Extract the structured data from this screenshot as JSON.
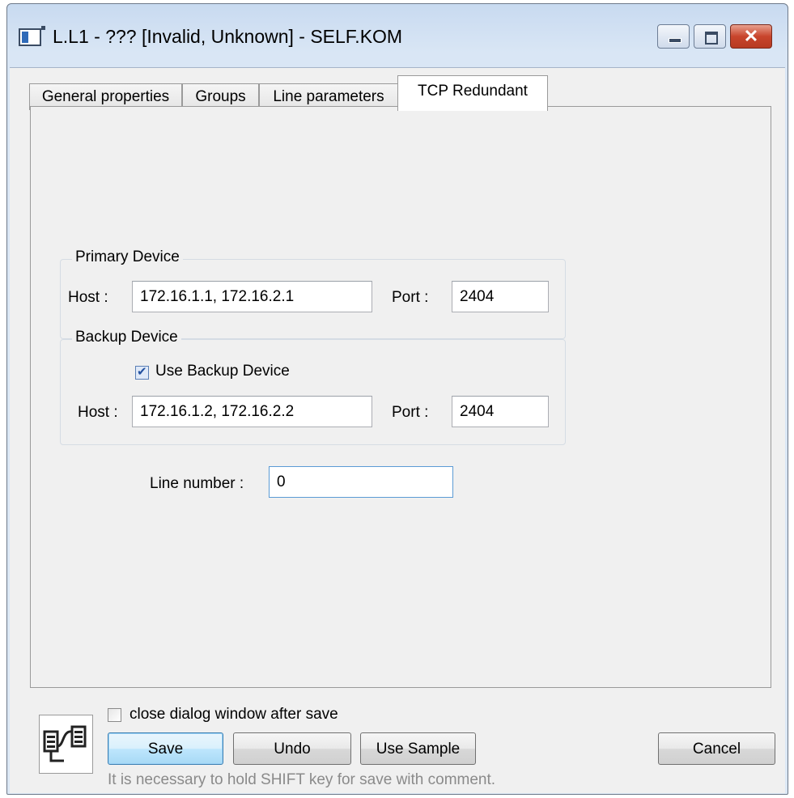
{
  "window": {
    "title": "L.L1 - ??? [Invalid, Unknown] - SELF.KOM",
    "close_glyph": "✕"
  },
  "tabs": [
    {
      "label": "General properties",
      "active": false
    },
    {
      "label": "Groups",
      "active": false
    },
    {
      "label": "Line parameters",
      "active": false
    },
    {
      "label": "TCP Redundant",
      "active": true
    }
  ],
  "primary": {
    "legend": "Primary Device",
    "host_label": "Host :",
    "host_value": "172.16.1.1, 172.16.2.1",
    "port_label": "Port :",
    "port_value": "2404"
  },
  "backup": {
    "legend": "Backup Device",
    "use_backup_label": "Use Backup Device",
    "use_backup_checked": true,
    "host_label": "Host :",
    "host_value": "172.16.1.2, 172.16.2.2",
    "port_label": "Port :",
    "port_value": "2404"
  },
  "line_number": {
    "label": "Line number :",
    "value": "0"
  },
  "footer": {
    "close_after_save_label": "close dialog window after save",
    "close_after_save_checked": false,
    "save_label": "Save",
    "undo_label": "Undo",
    "use_sample_label": "Use Sample",
    "cancel_label": "Cancel",
    "hint": "It is necessary to hold SHIFT key for save with comment."
  },
  "colors": {
    "accent": "#3c7fb1",
    "close_button": "#c8452c"
  }
}
